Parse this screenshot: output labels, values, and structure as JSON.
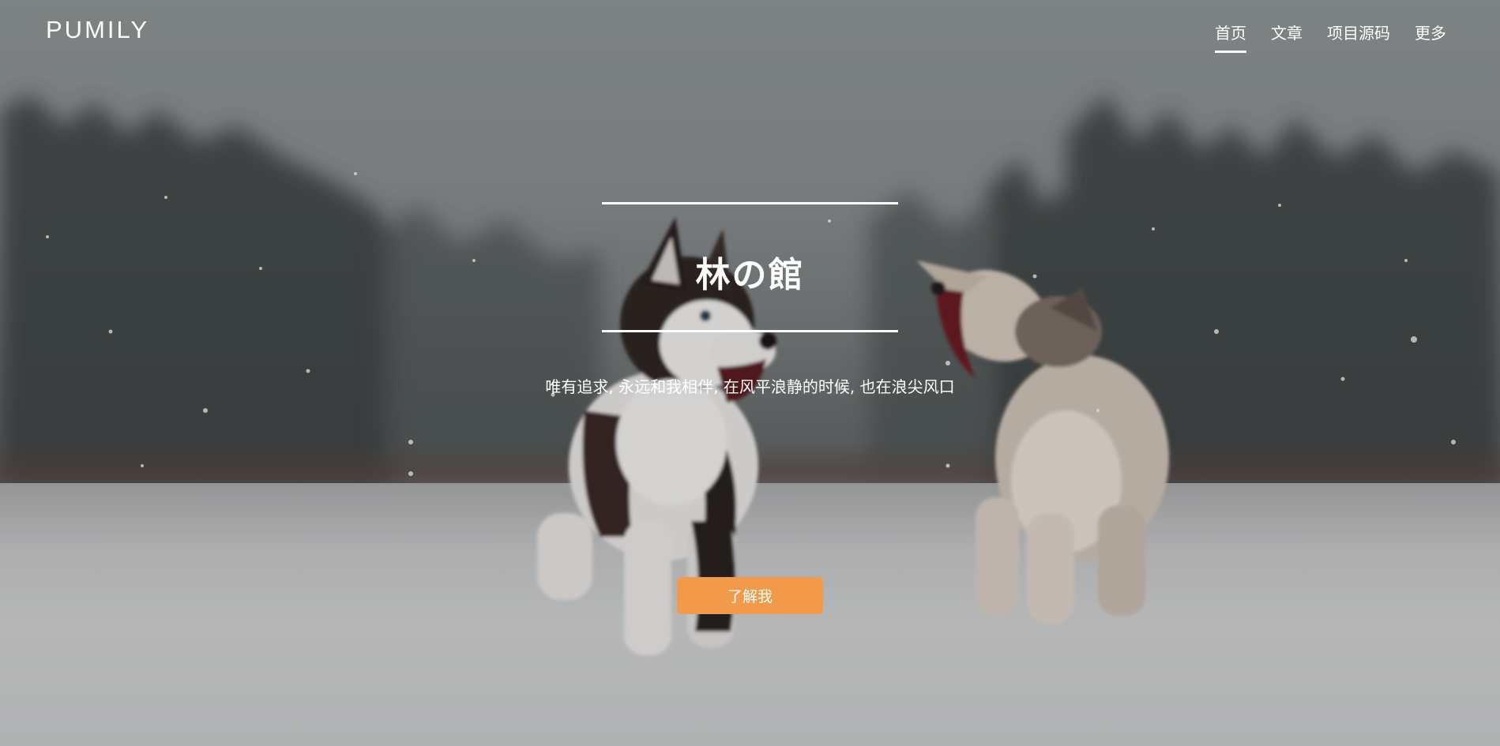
{
  "brand": {
    "name": "PUMILY"
  },
  "nav": {
    "items": [
      {
        "label": "首页",
        "active": true
      },
      {
        "label": "文章",
        "active": false
      },
      {
        "label": "项目源码",
        "active": false
      },
      {
        "label": "更多",
        "active": false
      }
    ]
  },
  "hero": {
    "title": "林の館",
    "subtitle": "唯有追求, 永远和我相伴, 在风平浪静的时候, 也在浪尖风口",
    "cta_label": "了解我",
    "background_image": "two husky puppies playing in snow"
  },
  "colors": {
    "accent": "#f3994a",
    "text": "#ffffff"
  }
}
